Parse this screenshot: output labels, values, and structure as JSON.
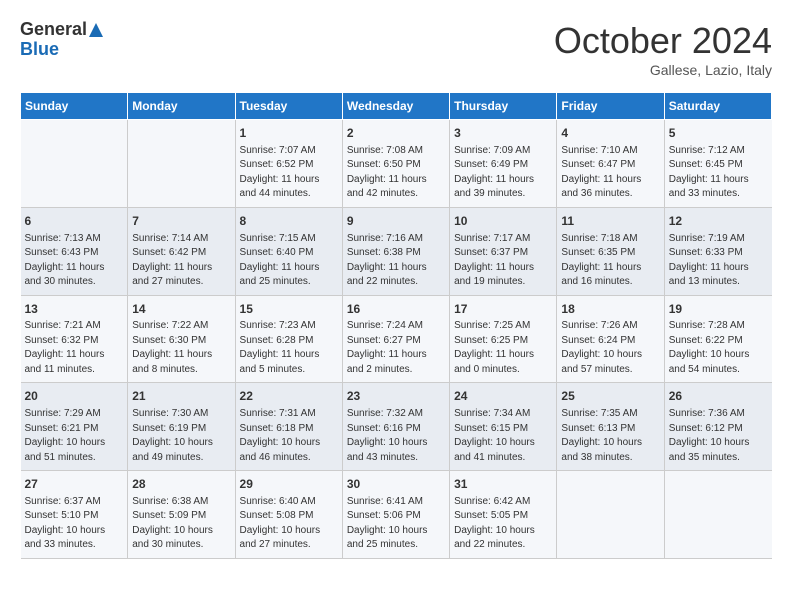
{
  "header": {
    "logo_line1": "General",
    "logo_line2": "Blue",
    "month": "October 2024",
    "location": "Gallese, Lazio, Italy"
  },
  "weekdays": [
    "Sunday",
    "Monday",
    "Tuesday",
    "Wednesday",
    "Thursday",
    "Friday",
    "Saturday"
  ],
  "weeks": [
    [
      {
        "day": "",
        "info": ""
      },
      {
        "day": "",
        "info": ""
      },
      {
        "day": "1",
        "info": "Sunrise: 7:07 AM\nSunset: 6:52 PM\nDaylight: 11 hours and 44 minutes."
      },
      {
        "day": "2",
        "info": "Sunrise: 7:08 AM\nSunset: 6:50 PM\nDaylight: 11 hours and 42 minutes."
      },
      {
        "day": "3",
        "info": "Sunrise: 7:09 AM\nSunset: 6:49 PM\nDaylight: 11 hours and 39 minutes."
      },
      {
        "day": "4",
        "info": "Sunrise: 7:10 AM\nSunset: 6:47 PM\nDaylight: 11 hours and 36 minutes."
      },
      {
        "day": "5",
        "info": "Sunrise: 7:12 AM\nSunset: 6:45 PM\nDaylight: 11 hours and 33 minutes."
      }
    ],
    [
      {
        "day": "6",
        "info": "Sunrise: 7:13 AM\nSunset: 6:43 PM\nDaylight: 11 hours and 30 minutes."
      },
      {
        "day": "7",
        "info": "Sunrise: 7:14 AM\nSunset: 6:42 PM\nDaylight: 11 hours and 27 minutes."
      },
      {
        "day": "8",
        "info": "Sunrise: 7:15 AM\nSunset: 6:40 PM\nDaylight: 11 hours and 25 minutes."
      },
      {
        "day": "9",
        "info": "Sunrise: 7:16 AM\nSunset: 6:38 PM\nDaylight: 11 hours and 22 minutes."
      },
      {
        "day": "10",
        "info": "Sunrise: 7:17 AM\nSunset: 6:37 PM\nDaylight: 11 hours and 19 minutes."
      },
      {
        "day": "11",
        "info": "Sunrise: 7:18 AM\nSunset: 6:35 PM\nDaylight: 11 hours and 16 minutes."
      },
      {
        "day": "12",
        "info": "Sunrise: 7:19 AM\nSunset: 6:33 PM\nDaylight: 11 hours and 13 minutes."
      }
    ],
    [
      {
        "day": "13",
        "info": "Sunrise: 7:21 AM\nSunset: 6:32 PM\nDaylight: 11 hours and 11 minutes."
      },
      {
        "day": "14",
        "info": "Sunrise: 7:22 AM\nSunset: 6:30 PM\nDaylight: 11 hours and 8 minutes."
      },
      {
        "day": "15",
        "info": "Sunrise: 7:23 AM\nSunset: 6:28 PM\nDaylight: 11 hours and 5 minutes."
      },
      {
        "day": "16",
        "info": "Sunrise: 7:24 AM\nSunset: 6:27 PM\nDaylight: 11 hours and 2 minutes."
      },
      {
        "day": "17",
        "info": "Sunrise: 7:25 AM\nSunset: 6:25 PM\nDaylight: 11 hours and 0 minutes."
      },
      {
        "day": "18",
        "info": "Sunrise: 7:26 AM\nSunset: 6:24 PM\nDaylight: 10 hours and 57 minutes."
      },
      {
        "day": "19",
        "info": "Sunrise: 7:28 AM\nSunset: 6:22 PM\nDaylight: 10 hours and 54 minutes."
      }
    ],
    [
      {
        "day": "20",
        "info": "Sunrise: 7:29 AM\nSunset: 6:21 PM\nDaylight: 10 hours and 51 minutes."
      },
      {
        "day": "21",
        "info": "Sunrise: 7:30 AM\nSunset: 6:19 PM\nDaylight: 10 hours and 49 minutes."
      },
      {
        "day": "22",
        "info": "Sunrise: 7:31 AM\nSunset: 6:18 PM\nDaylight: 10 hours and 46 minutes."
      },
      {
        "day": "23",
        "info": "Sunrise: 7:32 AM\nSunset: 6:16 PM\nDaylight: 10 hours and 43 minutes."
      },
      {
        "day": "24",
        "info": "Sunrise: 7:34 AM\nSunset: 6:15 PM\nDaylight: 10 hours and 41 minutes."
      },
      {
        "day": "25",
        "info": "Sunrise: 7:35 AM\nSunset: 6:13 PM\nDaylight: 10 hours and 38 minutes."
      },
      {
        "day": "26",
        "info": "Sunrise: 7:36 AM\nSunset: 6:12 PM\nDaylight: 10 hours and 35 minutes."
      }
    ],
    [
      {
        "day": "27",
        "info": "Sunrise: 6:37 AM\nSunset: 5:10 PM\nDaylight: 10 hours and 33 minutes."
      },
      {
        "day": "28",
        "info": "Sunrise: 6:38 AM\nSunset: 5:09 PM\nDaylight: 10 hours and 30 minutes."
      },
      {
        "day": "29",
        "info": "Sunrise: 6:40 AM\nSunset: 5:08 PM\nDaylight: 10 hours and 27 minutes."
      },
      {
        "day": "30",
        "info": "Sunrise: 6:41 AM\nSunset: 5:06 PM\nDaylight: 10 hours and 25 minutes."
      },
      {
        "day": "31",
        "info": "Sunrise: 6:42 AM\nSunset: 5:05 PM\nDaylight: 10 hours and 22 minutes."
      },
      {
        "day": "",
        "info": ""
      },
      {
        "day": "",
        "info": ""
      }
    ]
  ]
}
